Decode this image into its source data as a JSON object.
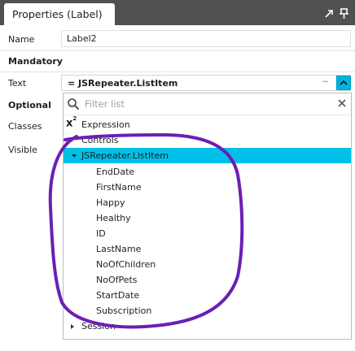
{
  "panel": {
    "title": "Properties (Label)"
  },
  "properties": {
    "name_label": "Name",
    "name_value": "Label2",
    "mandatory_heading": "Mandatory",
    "text_label": "Text",
    "text_value": "= JSRepeater.ListItem",
    "more_label": "···",
    "optional_heading": "Optional",
    "classes_label": "Classes",
    "visible_label": "Visible"
  },
  "dropdown": {
    "filter_placeholder": "Filter list",
    "expression_label": "Expression",
    "controls_label": "Controls",
    "selected_label": "JSRepeater.ListItem",
    "list_items": [
      "EndDate",
      "FirstName",
      "Happy",
      "Healthy",
      "ID",
      "LastName",
      "NoOfChildren",
      "NoOfPets",
      "StartDate",
      "Subscription"
    ],
    "session_label": "Session"
  },
  "colors": {
    "header_bg": "#505050",
    "selection": "#00c0e8",
    "annotation": "#6a1fb5"
  },
  "icons": {
    "pin": "pin-icon",
    "maximize": "maximize-icon",
    "filter": "search-icon",
    "clear": "close-icon",
    "dropdown": "chevron-up-icon"
  }
}
